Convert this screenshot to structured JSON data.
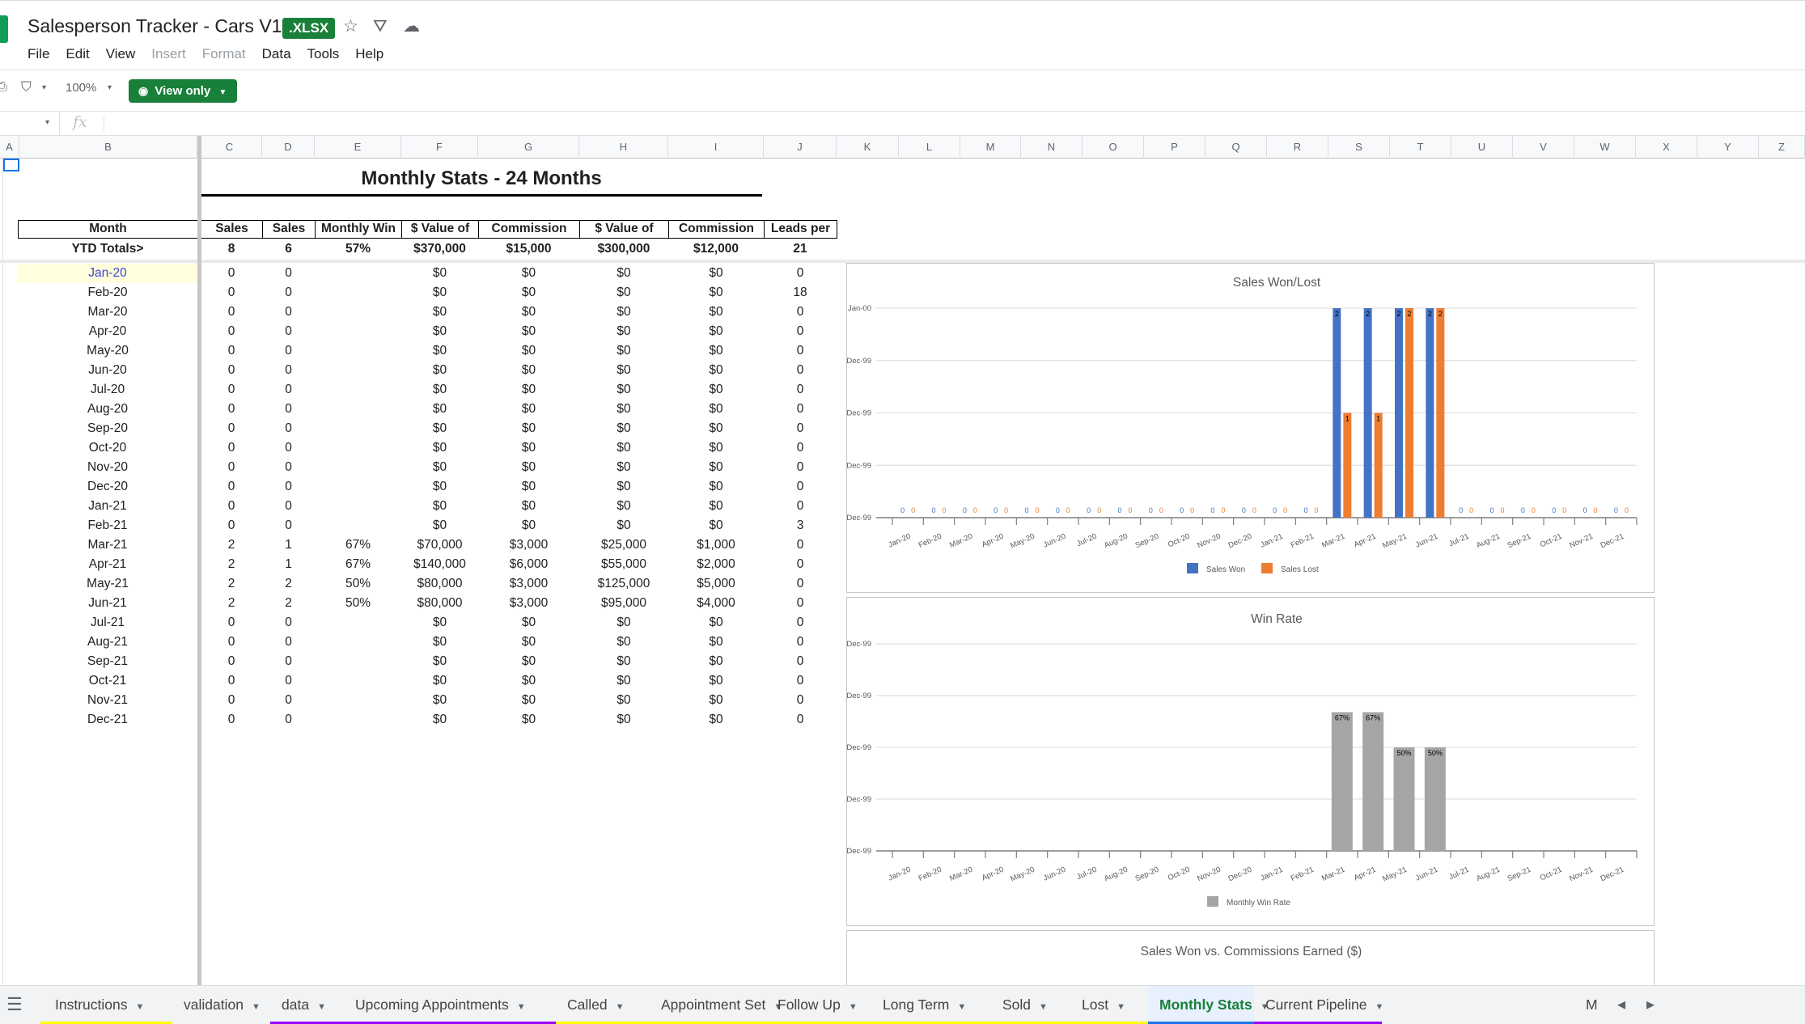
{
  "app": {
    "title": "Salesperson Tracker - Cars V1",
    "badge": ".XLSX",
    "menu": [
      "File",
      "Edit",
      "View",
      "Insert",
      "Format",
      "Data",
      "Tools",
      "Help"
    ],
    "menu_disabled": [
      "Insert",
      "Format"
    ]
  },
  "toolbar": {
    "zoom": "100%",
    "view_only_label": "View only",
    "fx": "fx"
  },
  "columns": [
    "A",
    "B",
    "C",
    "D",
    "E",
    "F",
    "G",
    "H",
    "I",
    "J",
    "K",
    "L",
    "M",
    "N",
    "O",
    "P",
    "Q",
    "R",
    "S",
    "T",
    "U",
    "V",
    "W",
    "X",
    "Y",
    "Z"
  ],
  "sheet": {
    "title": "Monthly Stats - 24 Months",
    "headers": [
      "Month",
      "Sales",
      "Sales",
      "Monthly Win",
      "$ Value of",
      "Commission",
      "$ Value of",
      "Commission",
      "Leads per"
    ],
    "totals": [
      "YTD Totals>",
      "8",
      "6",
      "57%",
      "$370,000",
      "$15,000",
      "$300,000",
      "$12,000",
      "21"
    ],
    "rows": [
      [
        "Jan-20",
        "0",
        "0",
        "",
        "$0",
        "$0",
        "$0",
        "$0",
        "0"
      ],
      [
        "Feb-20",
        "0",
        "0",
        "",
        "$0",
        "$0",
        "$0",
        "$0",
        "18"
      ],
      [
        "Mar-20",
        "0",
        "0",
        "",
        "$0",
        "$0",
        "$0",
        "$0",
        "0"
      ],
      [
        "Apr-20",
        "0",
        "0",
        "",
        "$0",
        "$0",
        "$0",
        "$0",
        "0"
      ],
      [
        "May-20",
        "0",
        "0",
        "",
        "$0",
        "$0",
        "$0",
        "$0",
        "0"
      ],
      [
        "Jun-20",
        "0",
        "0",
        "",
        "$0",
        "$0",
        "$0",
        "$0",
        "0"
      ],
      [
        "Jul-20",
        "0",
        "0",
        "",
        "$0",
        "$0",
        "$0",
        "$0",
        "0"
      ],
      [
        "Aug-20",
        "0",
        "0",
        "",
        "$0",
        "$0",
        "$0",
        "$0",
        "0"
      ],
      [
        "Sep-20",
        "0",
        "0",
        "",
        "$0",
        "$0",
        "$0",
        "$0",
        "0"
      ],
      [
        "Oct-20",
        "0",
        "0",
        "",
        "$0",
        "$0",
        "$0",
        "$0",
        "0"
      ],
      [
        "Nov-20",
        "0",
        "0",
        "",
        "$0",
        "$0",
        "$0",
        "$0",
        "0"
      ],
      [
        "Dec-20",
        "0",
        "0",
        "",
        "$0",
        "$0",
        "$0",
        "$0",
        "0"
      ],
      [
        "Jan-21",
        "0",
        "0",
        "",
        "$0",
        "$0",
        "$0",
        "$0",
        "0"
      ],
      [
        "Feb-21",
        "0",
        "0",
        "",
        "$0",
        "$0",
        "$0",
        "$0",
        "3"
      ],
      [
        "Mar-21",
        "2",
        "1",
        "67%",
        "$70,000",
        "$3,000",
        "$25,000",
        "$1,000",
        "0"
      ],
      [
        "Apr-21",
        "2",
        "1",
        "67%",
        "$140,000",
        "$6,000",
        "$55,000",
        "$2,000",
        "0"
      ],
      [
        "May-21",
        "2",
        "2",
        "50%",
        "$80,000",
        "$3,000",
        "$125,000",
        "$5,000",
        "0"
      ],
      [
        "Jun-21",
        "2",
        "2",
        "50%",
        "$80,000",
        "$3,000",
        "$95,000",
        "$4,000",
        "0"
      ],
      [
        "Jul-21",
        "0",
        "0",
        "",
        "$0",
        "$0",
        "$0",
        "$0",
        "0"
      ],
      [
        "Aug-21",
        "0",
        "0",
        "",
        "$0",
        "$0",
        "$0",
        "$0",
        "0"
      ],
      [
        "Sep-21",
        "0",
        "0",
        "",
        "$0",
        "$0",
        "$0",
        "$0",
        "0"
      ],
      [
        "Oct-21",
        "0",
        "0",
        "",
        "$0",
        "$0",
        "$0",
        "$0",
        "0"
      ],
      [
        "Nov-21",
        "0",
        "0",
        "",
        "$0",
        "$0",
        "$0",
        "$0",
        "0"
      ],
      [
        "Dec-21",
        "0",
        "0",
        "",
        "$0",
        "$0",
        "$0",
        "$0",
        "0"
      ]
    ]
  },
  "chart_data": [
    {
      "type": "bar",
      "title": "Sales Won/Lost",
      "categories": [
        "Jan-20",
        "Feb-20",
        "Mar-20",
        "Apr-20",
        "May-20",
        "Jun-20",
        "Jul-20",
        "Aug-20",
        "Sep-20",
        "Oct-20",
        "Nov-20",
        "Dec-20",
        "Jan-21",
        "Feb-21",
        "Mar-21",
        "Apr-21",
        "May-21",
        "Jun-21",
        "Jul-21",
        "Aug-21",
        "Sep-21",
        "Oct-21",
        "Nov-21",
        "Dec-21"
      ],
      "y_tick_labels": [
        "Jan-00",
        "Dec-99",
        "Dec-99",
        "Dec-99",
        "Dec-99"
      ],
      "ylim": [
        0,
        2
      ],
      "series": [
        {
          "name": "Sales Won",
          "color": "#4472c4",
          "values": [
            0,
            0,
            0,
            0,
            0,
            0,
            0,
            0,
            0,
            0,
            0,
            0,
            0,
            0,
            2,
            2,
            2,
            2,
            0,
            0,
            0,
            0,
            0,
            0
          ]
        },
        {
          "name": "Sales Lost",
          "color": "#ed7d31",
          "values": [
            0,
            0,
            0,
            0,
            0,
            0,
            0,
            0,
            0,
            0,
            0,
            0,
            0,
            0,
            1,
            1,
            2,
            2,
            0,
            0,
            0,
            0,
            0,
            0
          ]
        }
      ],
      "legend": "bottom"
    },
    {
      "type": "bar",
      "title": "Win Rate",
      "categories": [
        "Jan-20",
        "Feb-20",
        "Mar-20",
        "Apr-20",
        "May-20",
        "Jun-20",
        "Jul-20",
        "Aug-20",
        "Sep-20",
        "Oct-20",
        "Nov-20",
        "Dec-20",
        "Jan-21",
        "Feb-21",
        "Mar-21",
        "Apr-21",
        "May-21",
        "Jun-21",
        "Jul-21",
        "Aug-21",
        "Sep-21",
        "Oct-21",
        "Nov-21",
        "Dec-21"
      ],
      "y_tick_labels": [
        "Dec-99",
        "Dec-99",
        "Dec-99",
        "Dec-99",
        "Dec-99"
      ],
      "ylim": [
        0,
        1
      ],
      "series": [
        {
          "name": "Monthly Win Rate",
          "color": "#a5a5a5",
          "values": [
            null,
            null,
            null,
            null,
            null,
            null,
            null,
            null,
            null,
            null,
            null,
            null,
            null,
            null,
            0.67,
            0.67,
            0.5,
            0.5,
            null,
            null,
            null,
            null,
            null,
            null
          ],
          "labels": [
            "",
            "",
            "",
            "",
            "",
            "",
            "",
            "",
            "",
            "",
            "",
            "",
            "",
            "",
            "67%",
            "67%",
            "50%",
            "50%",
            "",
            "",
            "",
            "",
            "",
            ""
          ]
        }
      ],
      "legend": "bottom"
    },
    {
      "type": "bar",
      "title": "Sales Won vs. Commissions Earned ($)"
    }
  ],
  "tabs": [
    {
      "label": "Instructions",
      "color": "#ffff00"
    },
    {
      "label": "validation",
      "color": ""
    },
    {
      "label": "data",
      "color": "#9900ff"
    },
    {
      "label": "Upcoming Appointments",
      "color": "#9900ff"
    },
    {
      "label": "Called",
      "color": "#ffff00"
    },
    {
      "label": "Appointment Set",
      "color": "#ffff00"
    },
    {
      "label": "Follow Up",
      "color": "#ffff00"
    },
    {
      "label": "Long Term",
      "color": "#ffff00"
    },
    {
      "label": "Sold",
      "color": "#ffff00"
    },
    {
      "label": "Lost",
      "color": "#ffff00"
    },
    {
      "label": "Monthly Stats",
      "color": "#1a73e8",
      "active": true
    },
    {
      "label": "Current Pipeline",
      "color": "#9900ff"
    }
  ],
  "tab_overflow": "M"
}
